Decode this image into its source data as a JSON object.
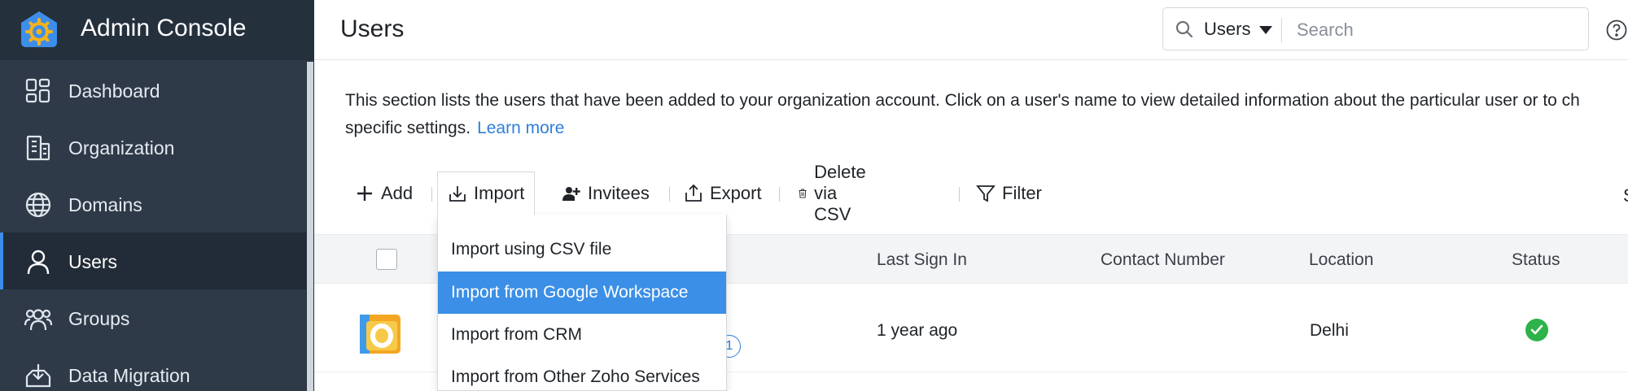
{
  "sidebar": {
    "app_title": "Admin Console",
    "items": [
      {
        "label": "Dashboard",
        "icon": "dashboard-icon",
        "active": false
      },
      {
        "label": "Organization",
        "icon": "building-icon",
        "active": false
      },
      {
        "label": "Domains",
        "icon": "globe-icon",
        "active": false
      },
      {
        "label": "Users",
        "icon": "user-icon",
        "active": true
      },
      {
        "label": "Groups",
        "icon": "groups-icon",
        "active": false
      },
      {
        "label": "Data Migration",
        "icon": "data-migration-icon",
        "active": false
      }
    ]
  },
  "header": {
    "title": "Users",
    "search": {
      "scope": "Users",
      "placeholder": "Search"
    }
  },
  "description": {
    "line1": "This section lists the users that have been added to your organization account. Click on a user's name to view detailed information about the particular user or to ch",
    "line2": "specific settings.",
    "learn_more": "Learn more"
  },
  "toolbar": {
    "add": "Add",
    "import": "Import",
    "invitees": "Invitees",
    "export": "Export",
    "delete_csv": "Delete via CSV",
    "filter": "Filter",
    "truncated_right": "S"
  },
  "import_menu": {
    "items": [
      {
        "label": "Import using CSV file",
        "selected": false
      },
      {
        "label": "Import from Google Workspace",
        "selected": true
      },
      {
        "label": "Import from CRM",
        "selected": false
      },
      {
        "label": "Import from Other Zoho Services",
        "selected": false
      }
    ]
  },
  "table": {
    "columns": [
      "Last Sign In",
      "Contact Number",
      "Location",
      "Status"
    ],
    "rows": [
      {
        "last_sign_in": "1 year ago",
        "contact_number": "",
        "location": "Delhi",
        "status": "active",
        "badge": "1"
      }
    ]
  },
  "colors": {
    "sidebar_bg": "#2e3a48",
    "accent": "#3b8fe6",
    "status_active": "#2eb24a",
    "link": "#2d7fdb"
  }
}
